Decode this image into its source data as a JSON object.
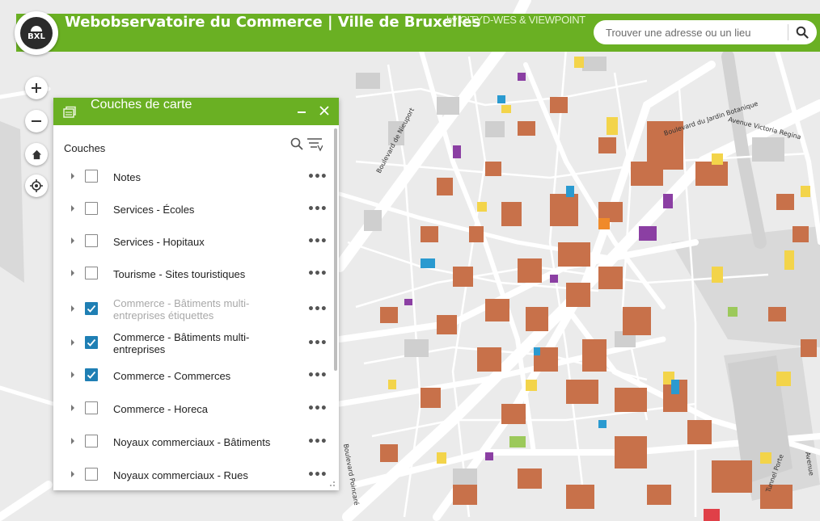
{
  "header": {
    "logo_text": "BXL",
    "title": "Webobservatoire du Commerce | Ville de Bruxelles",
    "subtitle": "by CITYD-WES & VIEWPOINT",
    "search": {
      "placeholder": "Trouver une adresse ou un lieu",
      "value": ""
    }
  },
  "map_controls": [
    "zoom-in",
    "zoom-out",
    "home",
    "locate"
  ],
  "map_labels": {
    "street1": "Boulevard de Nieuport",
    "street2": "Boulevard du Jardin Botanique",
    "street3": "Avenue Victoria Regina",
    "street4": "Boulevard Poincaré",
    "street5": "Avenue",
    "street6": "Tunnel Porte"
  },
  "panel": {
    "title": "Couches de carte",
    "subheader": "Couches",
    "layers": [
      {
        "label": "Notes",
        "checked": false,
        "dim": false
      },
      {
        "label": "Services - Écoles",
        "checked": false,
        "dim": false
      },
      {
        "label": "Services - Hopitaux",
        "checked": false,
        "dim": false
      },
      {
        "label": "Tourisme - Sites touristiques",
        "checked": false,
        "dim": false
      },
      {
        "label": "Commerce - Bâtiments multi-entreprises étiquettes",
        "checked": true,
        "dim": true
      },
      {
        "label": "Commerce - Bâtiments multi-entreprises",
        "checked": true,
        "dim": false
      },
      {
        "label": "Commerce - Commerces",
        "checked": true,
        "dim": false
      },
      {
        "label": "Commerce - Horeca",
        "checked": false,
        "dim": false
      },
      {
        "label": "Noyaux commerciaux - Bâtiments",
        "checked": false,
        "dim": false
      },
      {
        "label": "Noyaux commerciaux - Rues",
        "checked": false,
        "dim": false
      }
    ],
    "more_label": "•••"
  },
  "colors": {
    "accent_green": "#6ab023",
    "checkbox_blue": "#1f7fb4",
    "building_brown": "#c8714a",
    "building_yellow": "#f3d44a",
    "building_blue": "#2a9ad0",
    "building_purple": "#8b3fa3"
  }
}
